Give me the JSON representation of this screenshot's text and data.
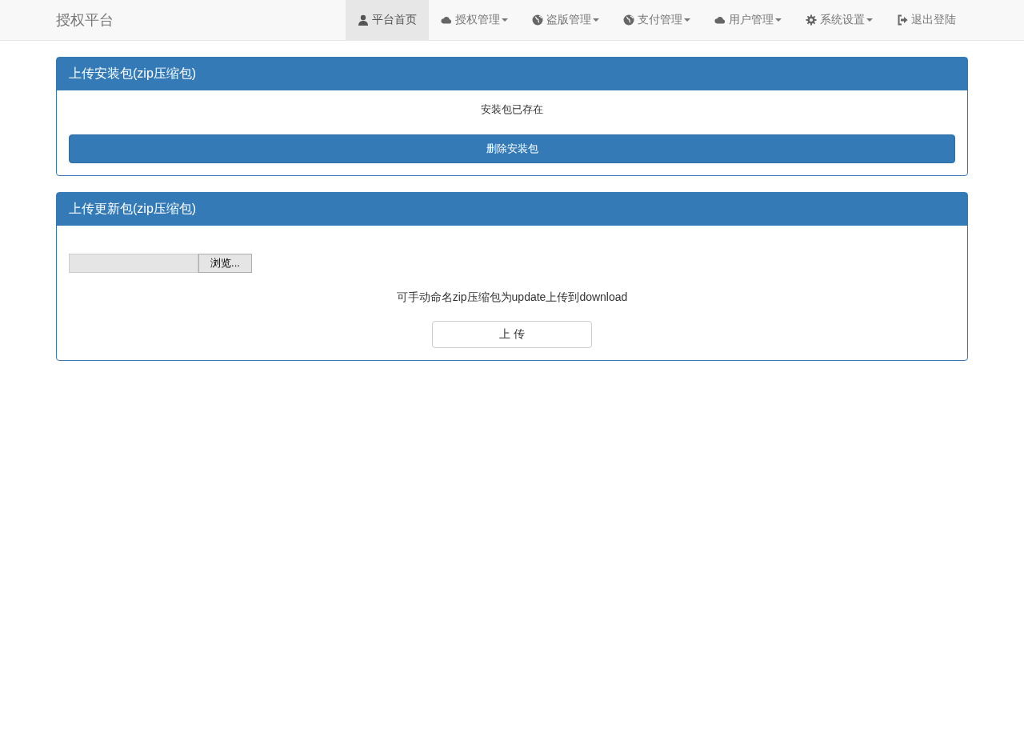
{
  "navbar": {
    "brand": "授权平台",
    "items": [
      {
        "label": "平台首页",
        "kind": "user",
        "dropdown": false,
        "selected": true
      },
      {
        "label": "授权管理",
        "kind": "cloud",
        "dropdown": true,
        "selected": false
      },
      {
        "label": "盗版管理",
        "kind": "globe",
        "dropdown": true,
        "selected": false
      },
      {
        "label": "支付管理",
        "kind": "globe",
        "dropdown": true,
        "selected": false
      },
      {
        "label": "用户管理",
        "kind": "cloud",
        "dropdown": true,
        "selected": false
      },
      {
        "label": "系统设置",
        "kind": "gear",
        "dropdown": true,
        "selected": false
      },
      {
        "label": "退出登陆",
        "kind": "logout",
        "dropdown": false,
        "selected": false
      }
    ]
  },
  "install_panel": {
    "title": "上传安装包(zip压缩包)",
    "status": "安装包已存在",
    "button": "删除安装包"
  },
  "update_panel": {
    "title": "上传更新包(zip压缩包)",
    "browse_button": "浏览...",
    "hint": "可手动命名zip压缩包为update上传到download",
    "upload_button": "上 传"
  }
}
